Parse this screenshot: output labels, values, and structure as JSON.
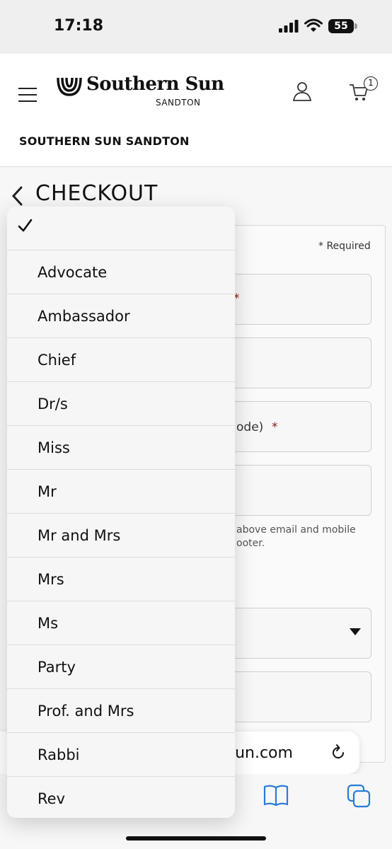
{
  "status_bar": {
    "time": "17:18",
    "battery": "55"
  },
  "header": {
    "logo_name": "Southern Sun",
    "logo_sub": "SANDTON",
    "cart_count": "1",
    "hotel_name": "SOUTHERN SUN SANDTON"
  },
  "checkout": {
    "title": "CHECKOUT",
    "required_note": "* Required",
    "field_labels": [
      "*",
      "",
      "ode)",
      ""
    ],
    "consent_text": "above email and mobile ooter."
  },
  "browser": {
    "address": "rnsun.com"
  },
  "picker": {
    "selected_index": 0,
    "options": [
      "",
      "Advocate",
      "Ambassador",
      "Chief",
      "Dr/s",
      "Miss",
      "Mr",
      "Mr and Mrs",
      "Mrs",
      "Ms",
      "Party",
      "Prof. and Mrs",
      "Rabbi",
      "Rev"
    ]
  }
}
